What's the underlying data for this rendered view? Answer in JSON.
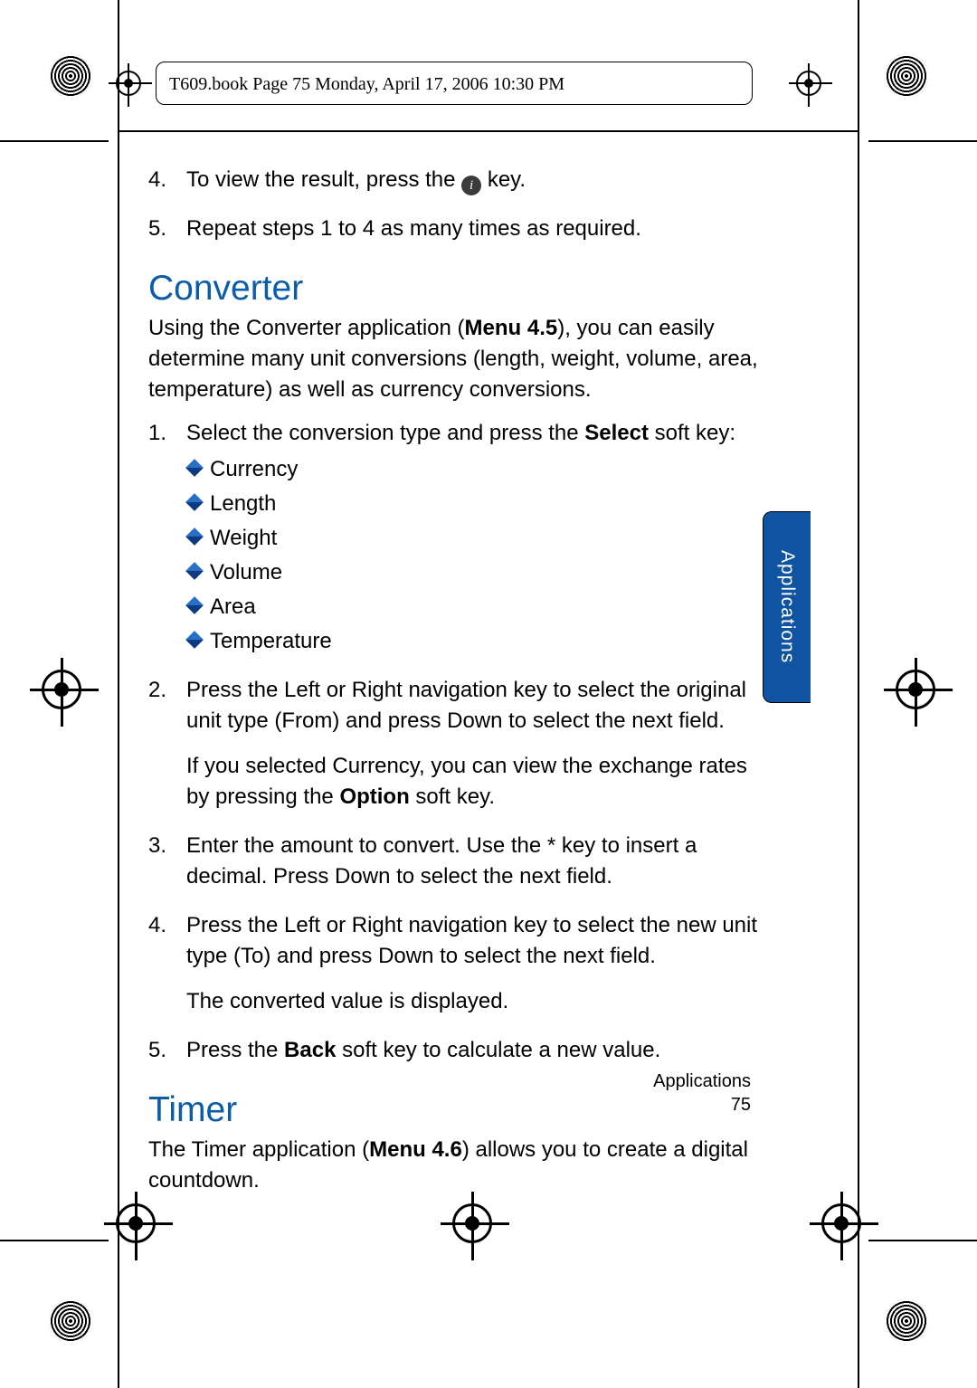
{
  "header_line": "T609.book  Page 75  Monday, April 17, 2006  10:30 PM",
  "intro_steps": [
    {
      "n": "4.",
      "text_before": "To view the result, press the ",
      "text_after": " key."
    },
    {
      "n": "5.",
      "text": "Repeat steps 1 to 4 as many times as required."
    }
  ],
  "converter": {
    "heading": "Converter",
    "para_before": "Using the Converter application (",
    "menu_label": "Menu 4.5",
    "para_after": "), you can easily determine many unit conversions (length, weight, volume, area, temperature) as well as currency conversions.",
    "steps": [
      {
        "n": "1.",
        "text_before": "Select the conversion type and press the ",
        "bold": "Select",
        "text_after": " soft key:"
      },
      {
        "n": "2.",
        "text": "Press the Left or Right navigation key to select the original unit type (From) and press Down to select the next field.",
        "extra_before": "If you selected Currency, you can view the exchange rates by pressing the ",
        "extra_bold": "Option",
        "extra_after": " soft key."
      },
      {
        "n": "3.",
        "text": "Enter the amount to convert. Use the *  key to insert a decimal. Press Down to select the next field."
      },
      {
        "n": "4.",
        "text": "Press the Left or Right navigation key to select the new unit type (To) and press Down to select the next field.",
        "extra": "The converted value is displayed."
      },
      {
        "n": "5.",
        "text_before": "Press the ",
        "bold": "Back",
        "text_after": " soft key to calculate a new value."
      }
    ],
    "bullets": [
      "Currency",
      "Length",
      "Weight",
      "Volume",
      "Area",
      "Temperature"
    ]
  },
  "timer": {
    "heading": "Timer",
    "para_before": "The Timer application (",
    "menu_label": "Menu 4.6",
    "para_after": ") allows you to create a digital countdown."
  },
  "tab_label": "Applications",
  "footer_section": "Applications",
  "footer_page": "75"
}
